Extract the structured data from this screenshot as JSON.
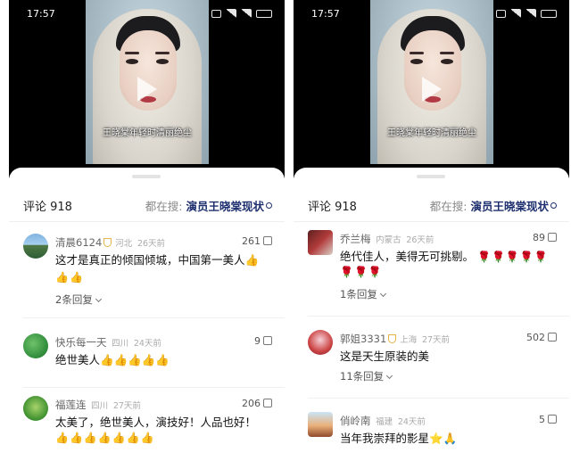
{
  "status_time": "17:57",
  "video_caption": "王晓棠年轻时清丽绝尘",
  "header": {
    "count_label": "评论 918",
    "searching_label": "都在搜:",
    "search_term": "演员王晓棠现状"
  },
  "left_comments": [
    {
      "user": "清晨6124",
      "location": "河北",
      "time": "26天前",
      "likes": "261",
      "text": "这才是真正的倾国倾城，中国第一美人",
      "inline_emoji": "👍",
      "emojis": "👍👍",
      "replies": "2条回复"
    },
    {
      "user": "快乐每一天",
      "location": "四川",
      "time": "24天前",
      "likes": "9",
      "text": "绝世美人",
      "inline_emoji": "👍👍👍👍👍"
    },
    {
      "user": "福莲连",
      "location": "四川",
      "time": "27天前",
      "likes": "206",
      "text": "太美了，绝世美人，演技好！人品也好！",
      "emojis": "👍👍👍👍👍👍👍"
    }
  ],
  "right_comments": [
    {
      "user": "乔兰梅",
      "location": "内蒙古",
      "time": "26天前",
      "likes": "89",
      "text": "绝代佳人，美得无可挑剔。",
      "inline_emoji": "🌹🌹🌹🌹🌹",
      "emojis": "🌹🌹🌹",
      "replies": "1条回复"
    },
    {
      "user": "郭姐3331",
      "location": "上海",
      "time": "27天前",
      "likes": "502",
      "text": "这是天生原装的美",
      "replies": "11条回复"
    },
    {
      "user": "俏岭南",
      "location": "福建",
      "time": "24天前",
      "likes": "5",
      "text": "当年我崇拜的影星",
      "inline_emoji": "⭐🙏"
    }
  ],
  "colors": {
    "accent_link": "#1d2f6e",
    "badge_gold": "#e6b54a"
  }
}
